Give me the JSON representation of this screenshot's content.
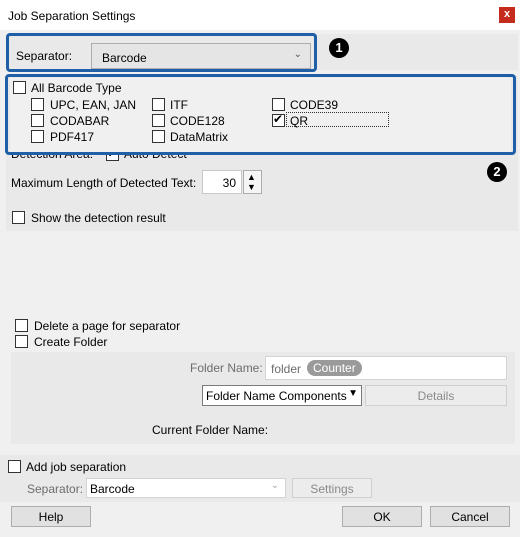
{
  "window": {
    "title": "Job Separation Settings",
    "close_glyph": "x"
  },
  "separator": {
    "label": "Separator:",
    "value": "Barcode"
  },
  "barcode": {
    "all_label": "All Barcode Type",
    "types": [
      {
        "label": "UPC, EAN, JAN",
        "checked": false
      },
      {
        "label": "ITF",
        "checked": false
      },
      {
        "label": "CODE39",
        "checked": false
      },
      {
        "label": "CODABAR",
        "checked": false
      },
      {
        "label": "CODE128",
        "checked": false
      },
      {
        "label": "QR",
        "checked": true
      },
      {
        "label": "PDF417",
        "checked": false
      },
      {
        "label": "DataMatrix",
        "checked": false
      }
    ]
  },
  "badges": {
    "one": "1",
    "two": "2"
  },
  "detection": {
    "area_label": "Detection Area:",
    "auto_detect_label": "Auto Detect",
    "max_length_label": "Maximum Length of Detected Text:",
    "max_length_value": "30",
    "show_result_label": "Show the detection result"
  },
  "options": {
    "delete_page_label": "Delete a page for separator",
    "create_folder_label": "Create Folder"
  },
  "folder": {
    "name_label": "Folder Name:",
    "name_value": "folder",
    "counter_tag": "Counter",
    "components_label": "Folder Name Components",
    "details_label": "Details",
    "current_label": "Current Folder Name:"
  },
  "job": {
    "add_label": "Add job separation",
    "separator_label": "Separator:",
    "separator_value": "Barcode",
    "settings_label": "Settings"
  },
  "buttons": {
    "help": "Help",
    "ok": "OK",
    "cancel": "Cancel"
  },
  "colors": {
    "highlight": "#1f5fa8",
    "close": "#c42b1c"
  }
}
